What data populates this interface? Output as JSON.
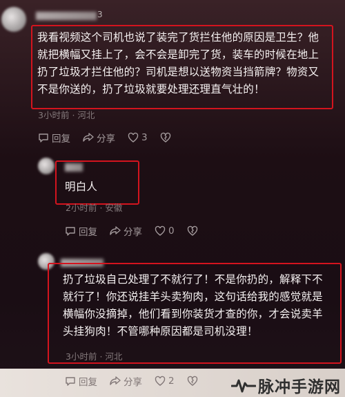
{
  "comments": [
    {
      "username_tail": "3",
      "text_lines": [
        "我看视频这个司机也说了装完了货拦住他的原因是卫生？他",
        "就把横幅又挂上了，会不会是卸完了货，装车的时候在地上",
        "扔了垃圾才拦住他的？司机是想以送物资当挡箭牌？物资又",
        "不是你送的，扔了垃圾就要处理还理直气壮的！"
      ],
      "time": "3小时前",
      "location": "河北",
      "reply_label": "回复",
      "share_label": "分享",
      "like_count": "3"
    },
    {
      "text_lines": [
        "明白人"
      ],
      "time": "2小时前",
      "location": "安徽",
      "reply_label": "回复",
      "share_label": "分享",
      "like_count": "0"
    },
    {
      "text_lines": [
        "扔了垃圾自己处理了不就行了！不是你扔的，解释下不",
        "就行了！你还说挂羊头卖狗肉，这句话给我的感觉就是",
        "横幅你没摘掉，他们看到你装货才查的你，才会说卖羊",
        "头挂狗肉！不管哪种原因都是司机没理！"
      ],
      "time": "3小时前",
      "location": "河北",
      "reply_label": "回复",
      "share_label": "分享",
      "like_count": "2"
    }
  ],
  "separator": "·",
  "watermark": {
    "text": "脉冲手游网"
  },
  "colors": {
    "highlight_box": "#d4141e",
    "meta_text": "#847a7c",
    "action_text": "#a39a9c"
  },
  "icons": [
    "reply-icon",
    "share-icon",
    "heart-icon",
    "dislike-icon"
  ]
}
